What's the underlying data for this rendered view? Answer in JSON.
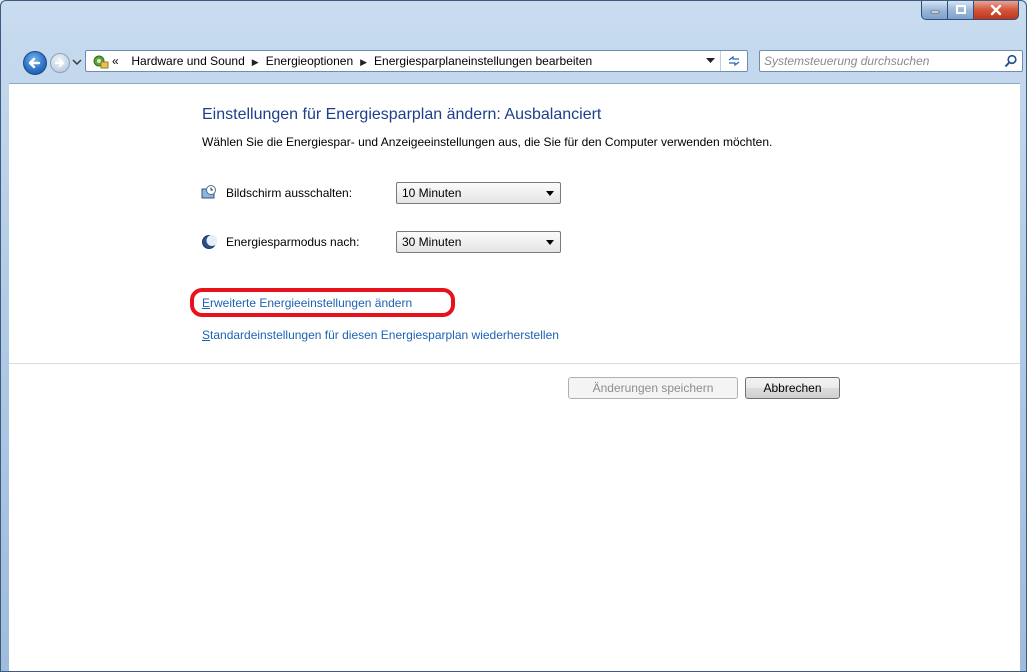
{
  "window": {
    "caption_buttons": [
      "minimize",
      "maximize",
      "close"
    ]
  },
  "address_bar": {
    "overflow_chevron": "«",
    "breadcrumbs": [
      "Hardware und Sound",
      "Energieoptionen",
      "Energiesparplaneinstellungen bearbeiten"
    ],
    "separator": "▶"
  },
  "search": {
    "placeholder": "Systemsteuerung durchsuchen"
  },
  "main": {
    "title": "Einstellungen für Energiesparplan ändern: Ausbalanciert",
    "subtitle": "Wählen Sie die Energiespar- und Anzeigeeinstellungen aus, die Sie für den Computer verwenden möchten.",
    "settings": [
      {
        "label": "Bildschirm ausschalten:",
        "value": "10 Minuten",
        "icon": "monitor-clock-icon"
      },
      {
        "label": "Energiesparmodus nach:",
        "value": "30 Minuten",
        "icon": "moon-sleep-icon"
      }
    ],
    "links": {
      "advanced_first": "E",
      "advanced_rest": "rweiterte Energieeinstellungen ändern",
      "restore_first": "S",
      "restore_rest": "tandardeinstellungen für diesen Energiesparplan wiederherstellen"
    },
    "buttons": {
      "save": "Änderungen speichern",
      "cancel": "Abbrechen"
    }
  },
  "colors": {
    "title": "#1e3f8a",
    "link": "#1b63b5",
    "highlight": "#e8121c"
  }
}
